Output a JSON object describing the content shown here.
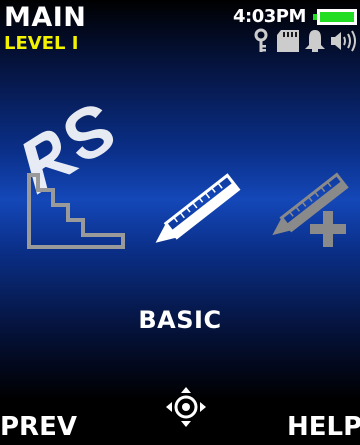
{
  "header": {
    "title": "MAIN",
    "level": "LEVEL I",
    "time": "4:03PM"
  },
  "status": {
    "battery_color": "#22dd22",
    "icons": [
      "key-icon",
      "memory-card-icon",
      "bell-icon",
      "speaker-icon"
    ]
  },
  "mode_icons": [
    "stairs-icon",
    "pencil-ruler-icon",
    "pencil-ruler-add-icon"
  ],
  "selected_mode": {
    "label": "BASIC"
  },
  "softkeys": {
    "left": "PREV",
    "right": "HELP",
    "center_icon": "nav-joystick-icon"
  },
  "colors": {
    "level_text": "#f3f300",
    "background_accent": "#1447b8",
    "watermark": "#ffffff"
  }
}
